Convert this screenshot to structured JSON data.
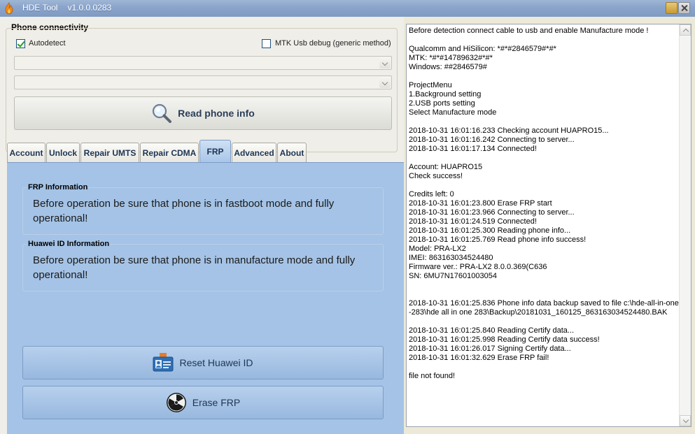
{
  "window": {
    "title": "HDE Tool",
    "version": "v1.0.0.0283"
  },
  "phone_connectivity": {
    "title": "Phone connectivity",
    "autodetect_label": "Autodetect",
    "autodetect_checked": true,
    "mtk_label": "MTK Usb debug (generic method)",
    "mtk_checked": false,
    "port_select_value": "",
    "device_select_value": "",
    "read_button_label": "Read phone info"
  },
  "tabs": [
    {
      "label": "Account",
      "active": false
    },
    {
      "label": "Unlock",
      "active": false
    },
    {
      "label": "Repair UMTS",
      "active": false
    },
    {
      "label": "Repair CDMA",
      "active": false
    },
    {
      "label": "FRP",
      "active": true
    },
    {
      "label": "Advanced",
      "active": false
    },
    {
      "label": "About",
      "active": false
    }
  ],
  "frp_panel": {
    "frp_info_title": "FRP Information",
    "frp_info_text": "Before operation be sure that phone is in fastboot mode and fully operational!",
    "huawei_info_title": "Huawei ID Information",
    "huawei_info_text": "Before operation be sure that phone is in manufacture mode and fully operational!",
    "reset_button_label": "Reset Huawei ID",
    "erase_button_label": "Erase FRP"
  },
  "log": {
    "text": "Before detection connect cable to usb and enable Manufacture mode !\n\nQualcomm and HiSilicon: *#*#2846579#*#*\nMTK: *#*#14789632#*#*\nWindows: ##2846579#\n\nProjectMenu\n1.Background setting\n2.USB ports setting\nSelect Manufacture mode\n\n2018-10-31 16:01:16.233 Checking account HUAPRO15...\n2018-10-31 16:01:16.242 Connecting to server...\n2018-10-31 16:01:17.134 Connected!\n\nAccount: HUAPRO15\nCheck success!\n\nCredits left: 0\n2018-10-31 16:01:23.800 Erase FRP start\n2018-10-31 16:01:23.966 Connecting to server...\n2018-10-31 16:01:24.519 Connected!\n2018-10-31 16:01:25.300 Reading phone info...\n2018-10-31 16:01:25.769 Read phone info success!\nModel: PRA-LX2\nIMEI: 863163034524480\nFirmware ver.: PRA-LX2 8.0.0.369(C636\nSN: 6MU7N17601003054\n\n\n2018-10-31 16:01:25.836 Phone info data backup saved to file c:\\hde-all-in-one-283\\hde all in one 283\\Backup\\20181031_160125_863163034524480.BAK\n\n2018-10-31 16:01:25.840 Reading Certify data...\n2018-10-31 16:01:25.998 Reading Certify data success!\n2018-10-31 16:01:26.017 Signing Certify data...\n2018-10-31 16:01:32.629 Erase FRP fail!\n\nfile not found!"
  }
}
